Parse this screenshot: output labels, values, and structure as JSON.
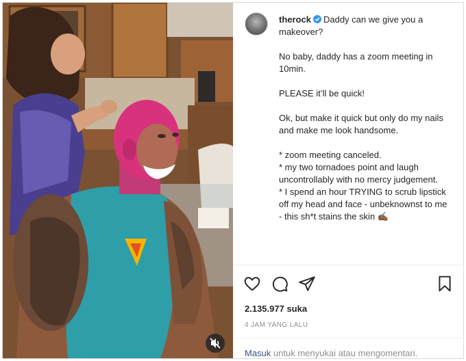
{
  "post": {
    "username": "therock",
    "caption_first": "Daddy can we give you a makeover?",
    "paragraphs": [
      "No baby, daddy has a zoom meeting in 10min.",
      "PLEASE it’ll be quick!",
      "Ok, but make it quick but only do my nails and make me look handsome."
    ],
    "bullets": [
      "* zoom meeting canceled.",
      "* my two tornadoes point and laugh uncontrollably with no mercy judgement.",
      "* I spend an hour TRYING to scrub lipstick off my head and face - unbeknownst to me - this sh*t stains the skin ✍🏾"
    ],
    "likes": "2.135.977 suka",
    "time": "4 JAM YANG LALU"
  },
  "footer": {
    "login_link": "Masuk",
    "login_rest": " untuk menyukai atau mengomentari."
  },
  "icons": {
    "verified": "verified-badge-icon",
    "like": "heart-icon",
    "comment": "comment-icon",
    "share": "share-icon",
    "save": "bookmark-icon",
    "mute": "speaker-muted-icon"
  },
  "colors": {
    "verified": "#3897f0",
    "text": "#262626",
    "muted": "#8e8e8e"
  }
}
